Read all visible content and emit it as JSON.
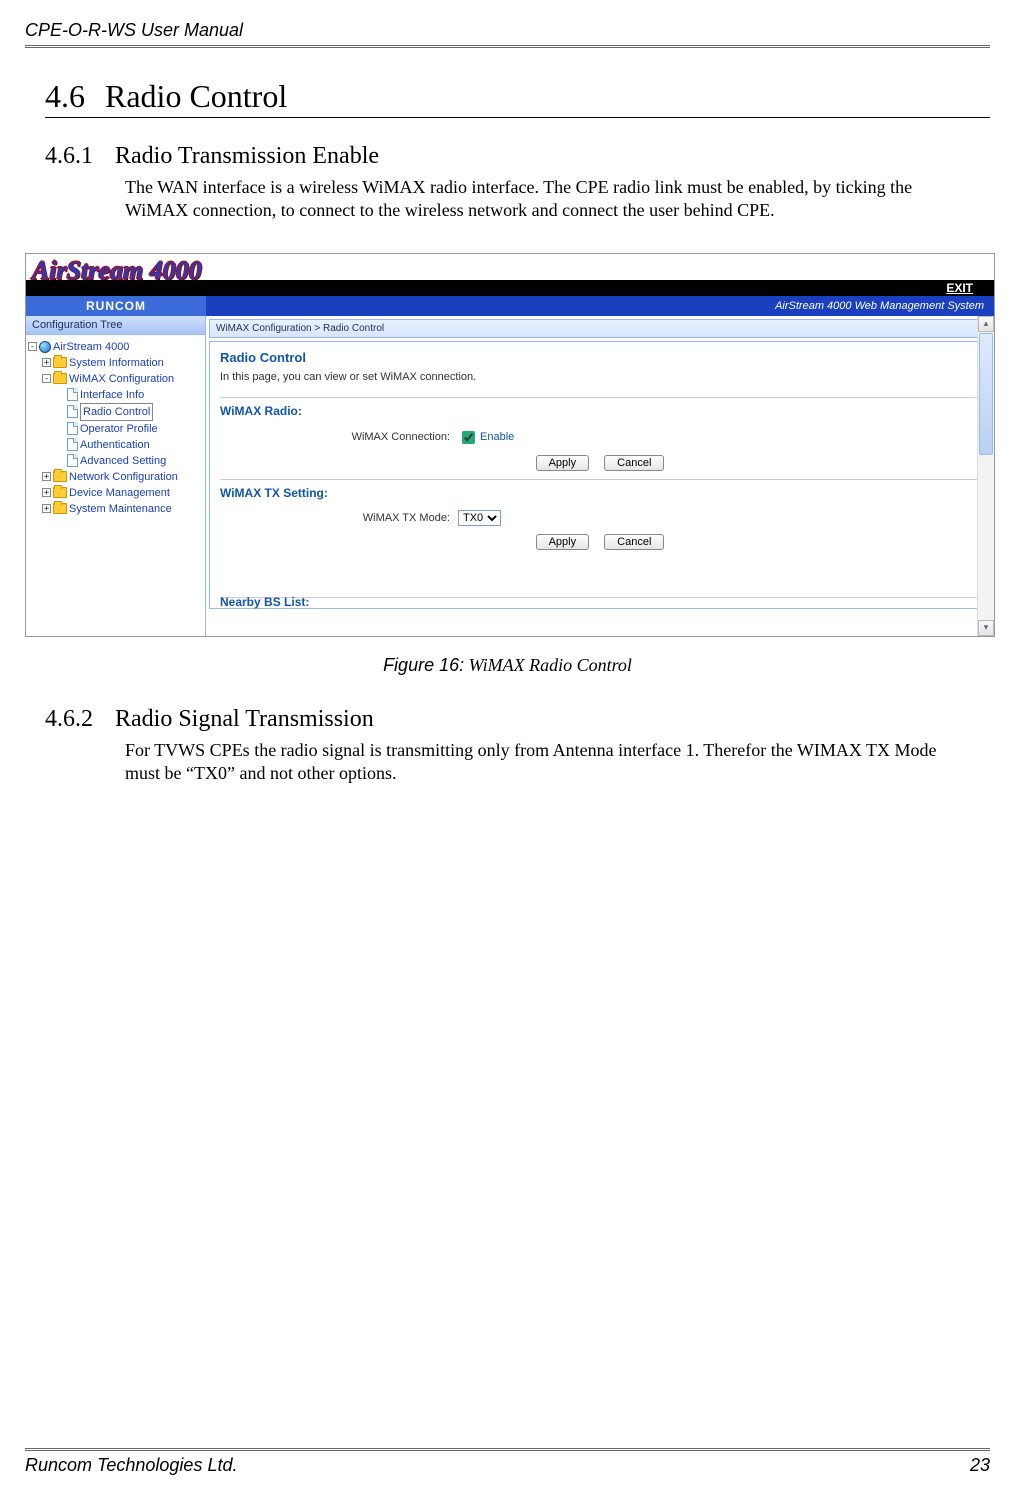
{
  "doc": {
    "header": "CPE-O-R-WS User Manual",
    "footer_left": "Runcom Technologies Ltd.",
    "footer_right": "23"
  },
  "sections": {
    "s46_num": "4.6",
    "s46_title": "Radio Control",
    "s461_num": "4.6.1",
    "s461_title": "Radio Transmission Enable",
    "s461_body": "The WAN interface is a wireless WiMAX radio interface. The CPE radio link must be enabled, by ticking the WiMAX connection, to connect to the wireless network and connect the user behind CPE.",
    "fig_label": "Figure 16:",
    "fig_text": "  WiMAX Radio Control",
    "s462_num": "4.6.2",
    "s462_title": "Radio Signal Transmission",
    "s462_body": "For TVWS CPEs the radio signal is transmitting only from Antenna interface 1. Therefor the WIMAX TX Mode must be “TX0” and not other options."
  },
  "shot": {
    "brand": "AirStream 4000",
    "exit": "EXIT",
    "runcom": "RUNCOM",
    "mgmt": "AirStream 4000 Web Management System",
    "conf_tree": "Configuration Tree",
    "tree": {
      "root": "AirStream 4000",
      "sys_info": "System Information",
      "wimax_conf": "WiMAX Configuration",
      "iface": "Interface Info",
      "radio": "Radio Control",
      "oper": "Operator Profile",
      "auth": "Authentication",
      "adv": "Advanced Setting",
      "net": "Network Configuration",
      "dev": "Device Management",
      "maint": "System Maintenance"
    },
    "crumb": "WiMAX Configuration > Radio Control",
    "panel_title": "Radio Control",
    "panel_desc": "In this page, you can view or set WiMAX connection.",
    "sec1": "WiMAX Radio:",
    "conn_label": "WiMAX Connection:",
    "enable": "Enable",
    "apply": "Apply",
    "cancel": "Cancel",
    "sec2": "WiMAX TX Setting:",
    "txmode_label": "WiMAX TX Mode:",
    "txmode_value": "TX0",
    "cutoff": "Nearby BS List:"
  }
}
